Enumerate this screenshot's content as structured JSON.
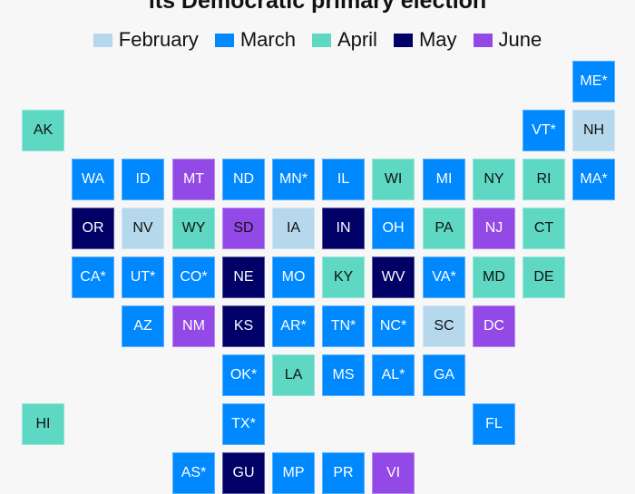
{
  "title": "its Democratic primary election",
  "legend": [
    {
      "key": "feb",
      "label": "February",
      "color": "#b6d8ec"
    },
    {
      "key": "mar",
      "label": "March",
      "color": "#0088ff"
    },
    {
      "key": "apr",
      "label": "April",
      "color": "#5ed8c2"
    },
    {
      "key": "may",
      "label": "May",
      "color": "#000066"
    },
    {
      "key": "jun",
      "label": "June",
      "color": "#9349e6"
    }
  ],
  "tiles": [
    {
      "label": "ME*",
      "month": "mar",
      "row": 0,
      "col": 11
    },
    {
      "label": "AK",
      "month": "apr",
      "row": 1,
      "col": 0
    },
    {
      "label": "VT*",
      "month": "mar",
      "row": 1,
      "col": 10
    },
    {
      "label": "NH",
      "month": "feb",
      "row": 1,
      "col": 11
    },
    {
      "label": "WA",
      "month": "mar",
      "row": 2,
      "col": 1
    },
    {
      "label": "ID",
      "month": "mar",
      "row": 2,
      "col": 2
    },
    {
      "label": "MT",
      "month": "jun",
      "row": 2,
      "col": 3
    },
    {
      "label": "ND",
      "month": "mar",
      "row": 2,
      "col": 4
    },
    {
      "label": "MN*",
      "month": "mar",
      "row": 2,
      "col": 5
    },
    {
      "label": "IL",
      "month": "mar",
      "row": 2,
      "col": 6
    },
    {
      "label": "WI",
      "month": "apr",
      "row": 2,
      "col": 7
    },
    {
      "label": "MI",
      "month": "mar",
      "row": 2,
      "col": 8
    },
    {
      "label": "NY",
      "month": "apr",
      "row": 2,
      "col": 9
    },
    {
      "label": "RI",
      "month": "apr",
      "row": 2,
      "col": 10
    },
    {
      "label": "MA*",
      "month": "mar",
      "row": 2,
      "col": 11
    },
    {
      "label": "OR",
      "month": "may",
      "row": 3,
      "col": 1
    },
    {
      "label": "NV",
      "month": "feb",
      "row": 3,
      "col": 2
    },
    {
      "label": "WY",
      "month": "apr",
      "row": 3,
      "col": 3
    },
    {
      "label": "SD",
      "month": "jun",
      "row": 3,
      "col": 4,
      "dark_text": true
    },
    {
      "label": "IA",
      "month": "feb",
      "row": 3,
      "col": 5
    },
    {
      "label": "IN",
      "month": "may",
      "row": 3,
      "col": 6
    },
    {
      "label": "OH",
      "month": "mar",
      "row": 3,
      "col": 7
    },
    {
      "label": "PA",
      "month": "apr",
      "row": 3,
      "col": 8
    },
    {
      "label": "NJ",
      "month": "jun",
      "row": 3,
      "col": 9
    },
    {
      "label": "CT",
      "month": "apr",
      "row": 3,
      "col": 10
    },
    {
      "label": "CA*",
      "month": "mar",
      "row": 4,
      "col": 1
    },
    {
      "label": "UT*",
      "month": "mar",
      "row": 4,
      "col": 2
    },
    {
      "label": "CO*",
      "month": "mar",
      "row": 4,
      "col": 3
    },
    {
      "label": "NE",
      "month": "may",
      "row": 4,
      "col": 4
    },
    {
      "label": "MO",
      "month": "mar",
      "row": 4,
      "col": 5
    },
    {
      "label": "KY",
      "month": "apr",
      "row": 4,
      "col": 6
    },
    {
      "label": "WV",
      "month": "may",
      "row": 4,
      "col": 7
    },
    {
      "label": "VA*",
      "month": "mar",
      "row": 4,
      "col": 8
    },
    {
      "label": "MD",
      "month": "apr",
      "row": 4,
      "col": 9
    },
    {
      "label": "DE",
      "month": "apr",
      "row": 4,
      "col": 10
    },
    {
      "label": "AZ",
      "month": "mar",
      "row": 5,
      "col": 2
    },
    {
      "label": "NM",
      "month": "jun",
      "row": 5,
      "col": 3
    },
    {
      "label": "KS",
      "month": "may",
      "row": 5,
      "col": 4
    },
    {
      "label": "AR*",
      "month": "mar",
      "row": 5,
      "col": 5
    },
    {
      "label": "TN*",
      "month": "mar",
      "row": 5,
      "col": 6
    },
    {
      "label": "NC*",
      "month": "mar",
      "row": 5,
      "col": 7
    },
    {
      "label": "SC",
      "month": "feb",
      "row": 5,
      "col": 8
    },
    {
      "label": "DC",
      "month": "jun",
      "row": 5,
      "col": 9
    },
    {
      "label": "OK*",
      "month": "mar",
      "row": 6,
      "col": 4
    },
    {
      "label": "LA",
      "month": "apr",
      "row": 6,
      "col": 5
    },
    {
      "label": "MS",
      "month": "mar",
      "row": 6,
      "col": 6
    },
    {
      "label": "AL*",
      "month": "mar",
      "row": 6,
      "col": 7
    },
    {
      "label": "GA",
      "month": "mar",
      "row": 6,
      "col": 8
    },
    {
      "label": "HI",
      "month": "apr",
      "row": 7,
      "col": 0
    },
    {
      "label": "TX*",
      "month": "mar",
      "row": 7,
      "col": 4
    },
    {
      "label": "FL",
      "month": "mar",
      "row": 7,
      "col": 9
    },
    {
      "label": "AS*",
      "month": "mar",
      "row": 8,
      "col": 3
    },
    {
      "label": "GU",
      "month": "may",
      "row": 8,
      "col": 4
    },
    {
      "label": "MP",
      "month": "mar",
      "row": 8,
      "col": 5
    },
    {
      "label": "PR",
      "month": "mar",
      "row": 8,
      "col": 6
    },
    {
      "label": "VI",
      "month": "jun",
      "row": 8,
      "col": 7
    }
  ]
}
